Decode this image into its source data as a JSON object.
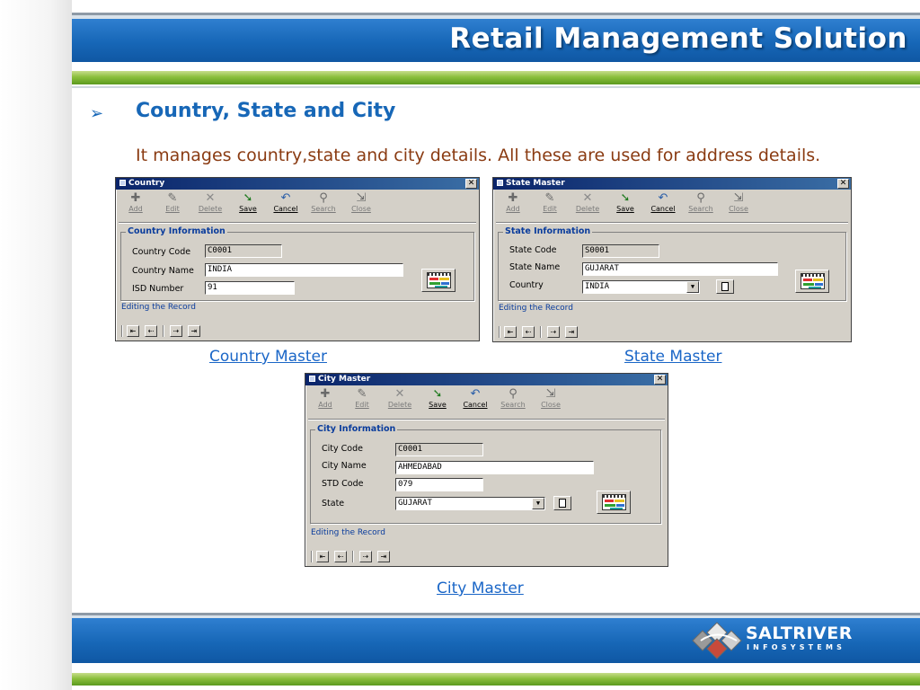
{
  "header": {
    "title": "Retail Management Solution"
  },
  "section": {
    "bullet": "➢",
    "title": "Country, State and City",
    "description": "It manages country,state and city details. All these are used for address details."
  },
  "toolbar": {
    "add": "Add",
    "edit": "Edit",
    "delete": "Delete",
    "save": "Save",
    "cancel": "Cancel",
    "search": "Search",
    "close": "Close"
  },
  "country_window": {
    "title": "Country",
    "group_title": "Country Information",
    "labels": {
      "code": "Country Code",
      "name": "Country Name",
      "isd": "ISD Number"
    },
    "values": {
      "code": "C0001",
      "name": "INDIA",
      "isd": "91"
    },
    "status": "Editing the Record"
  },
  "state_window": {
    "title": "State Master",
    "group_title": "State Information",
    "labels": {
      "code": "State Code",
      "name": "State Name",
      "country": "Country"
    },
    "values": {
      "code": "S0001",
      "name": "GUJARAT",
      "country": "INDIA"
    },
    "status": "Editing the Record"
  },
  "city_window": {
    "title": "City Master",
    "group_title": "City Information",
    "labels": {
      "code": "City Code",
      "name": "City Name",
      "std": "STD Code",
      "state": "State"
    },
    "values": {
      "code": "C0001",
      "name": "AHMEDABAD",
      "std": "079",
      "state": "GUJARAT"
    },
    "status": "Editing the Record"
  },
  "captions": {
    "country": "Country Master",
    "state": "State Master",
    "city": "City Master"
  },
  "footer": {
    "logo_name": "SALTRIVER",
    "logo_sub": "INFOSYSTEMS"
  },
  "colors": {
    "banner_blue": "#1767b7",
    "banner_green": "#8bbf3c",
    "title_blue": "#1767b7",
    "desc_brown": "#8a3b12",
    "link_blue": "#1a66c7"
  },
  "icons": {
    "close": "close-icon",
    "add": "add-icon",
    "edit": "edit-icon",
    "delete": "delete-icon",
    "save": "save-icon",
    "cancel": "cancel-icon",
    "search": "search-icon",
    "exit": "close-door-icon",
    "calendar": "calendar-icon",
    "document": "document-icon",
    "dropdown": "chevron-down-icon"
  }
}
